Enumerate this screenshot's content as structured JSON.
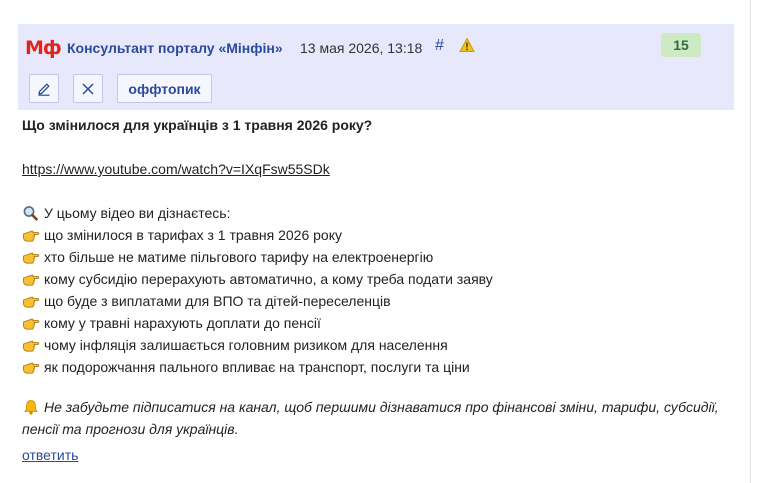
{
  "post": {
    "logo_text": "Мф",
    "author": "Консультант порталу «Мінфін»",
    "date": "13 мая 2026, 13:18",
    "hash": "#",
    "score": "15",
    "offtopic_label": "оффтопик",
    "title": "Що змінилося для українців з 1 травня 2026 року?",
    "link": "https://www.youtube.com/watch?v=IXqFsw55SDk",
    "intro": "У цьому відео ви дізнаєтесь:",
    "bullets": [
      "що змінилося в тарифах з 1 травня 2026 року",
      "хто більше не матиме пільгового тарифу на електроенергію",
      "кому субсидію перерахують автоматично, а кому треба подати заяву",
      "що буде з виплатами для ВПО та дітей-переселенців",
      "кому у травні нарахують доплати до пенсії",
      "чому інфляція залишається головним ризиком для населення",
      "як подорожчання пального впливає на транспорт, послуги та ціни"
    ],
    "footer_line1": "Не забудьте підписатися на канал, щоб першими дізнаватися про фінансові зміни, тарифи, субсидії,",
    "footer_line2": "пенсії та прогнози для українців.",
    "reply_label": "ответить"
  },
  "icons": {
    "logo": "minfin-logo",
    "edit": "pencil-icon",
    "close": "close-icon",
    "warn": "warning-icon",
    "intro": "magnifier-icon",
    "bullet": "pointing-hand-icon",
    "footer": "bell-icon"
  },
  "colors": {
    "header_bg": "#e8e8fd",
    "link_blue": "#2a4a9a",
    "logo_red": "#e0251b",
    "score_bg": "#cdeac4",
    "score_text": "#2d6e3a"
  }
}
